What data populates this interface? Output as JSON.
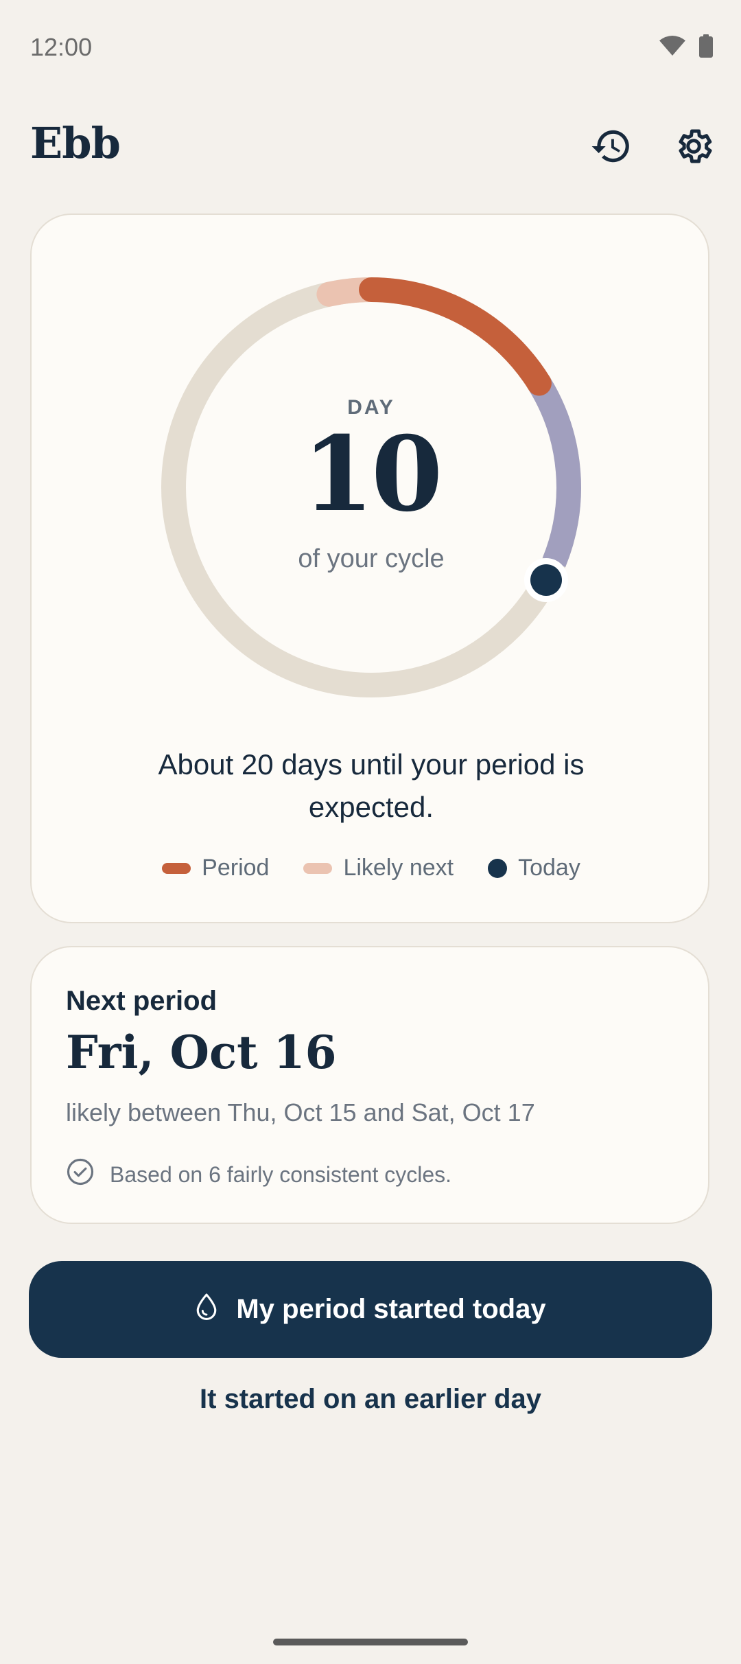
{
  "status_bar": {
    "time": "12:00"
  },
  "app": {
    "title": "Ebb"
  },
  "cycle": {
    "day_label": "DAY",
    "day_number": "10",
    "day_sub": "of your cycle",
    "countdown": "About 20 days until your period is expected."
  },
  "legend": {
    "period": "Period",
    "likely_next": "Likely next",
    "today": "Today"
  },
  "next_period": {
    "label": "Next period",
    "date": "Fri, Oct 16",
    "range": "likely between Thu, Oct 15 and Sat, Oct 17",
    "basis": "Based on 6 fairly consistent cycles."
  },
  "actions": {
    "primary": "My period started today",
    "secondary": "It started on an earlier day"
  },
  "colors": {
    "period": "#c5603b",
    "likely_next": "#ebc3b1",
    "fertile": "#a19fbe",
    "track": "#e4ddd1",
    "today": "#17334c"
  },
  "icons": {
    "history": "history-icon",
    "settings": "gear-icon",
    "drop": "drop-icon",
    "check": "check-circle-icon"
  }
}
